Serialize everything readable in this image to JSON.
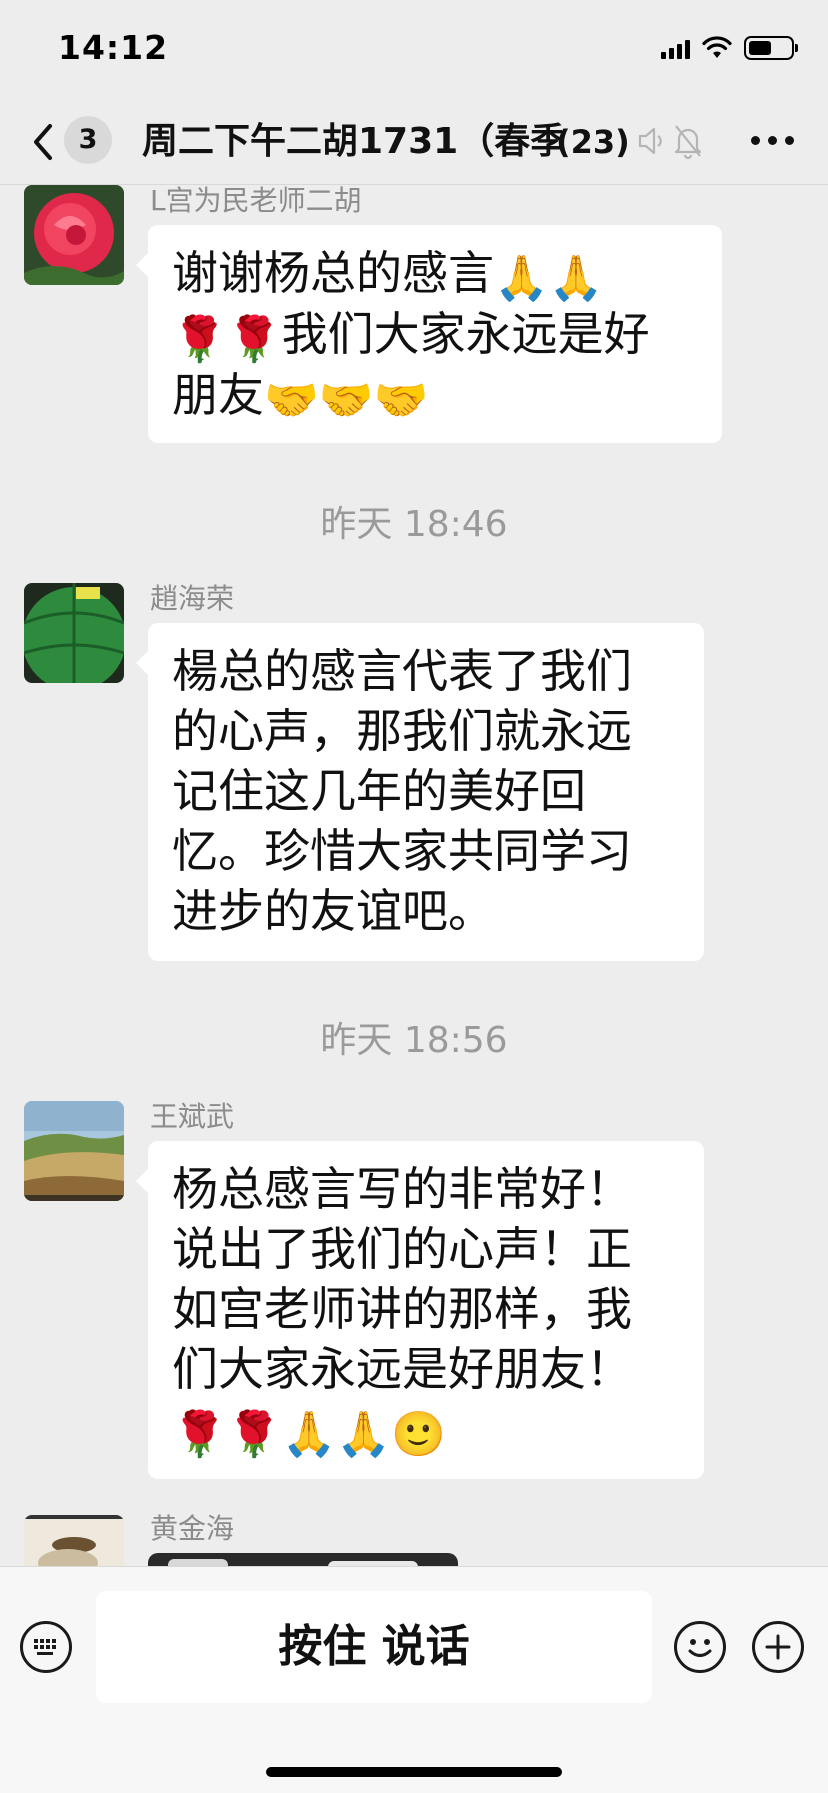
{
  "status_bar": {
    "time": "14:12",
    "battery_level": 0.55
  },
  "nav": {
    "back_icon": "chevron-left-icon",
    "unread_count": "3",
    "title": "周二下午二胡1731（春季）",
    "member_count": "(23)",
    "voice_off_icon": "speaker-off-icon",
    "mute_icon": "bell-slash-icon",
    "more_icon": "ellipsis-icon"
  },
  "messages": [
    {
      "sender": "L宫为民老师二胡",
      "avatar": "rose",
      "lines": [
        "谢谢杨总的感言",
        "我们大家永远是好",
        "朋友"
      ],
      "emojis": [
        "🙏",
        "🙏",
        "🌹",
        "🌹",
        "🤝",
        "🤝",
        "🤝"
      ]
    },
    {
      "timestamp": "昨天 18:46"
    },
    {
      "sender": "趙海荣",
      "avatar": "green-ball",
      "lines": [
        "楊总的感言代表了我们",
        "的心声，那我们就永远",
        "记住这几年的美好回",
        "忆。珍惜大家共同学习",
        "进步的友谊吧。"
      ]
    },
    {
      "timestamp": "昨天 18:56"
    },
    {
      "sender": "王斌武",
      "avatar": "landscape",
      "lines": [
        "杨总感言写的非常好！",
        "说出了我们的心声！正",
        "如宫老师讲的那样，我",
        "们大家永远是好朋友！"
      ],
      "emojis": [
        "🌹",
        "🌹",
        "🙏",
        "🙏",
        "🙂"
      ]
    },
    {
      "sender": "黄金海",
      "avatar": "partial-photo"
    }
  ],
  "input_bar": {
    "keyboard_icon": "keyboard-icon",
    "hold_to_talk": "按住 说话",
    "emoji_icon": "smiley-icon",
    "plus_icon": "plus-icon"
  }
}
